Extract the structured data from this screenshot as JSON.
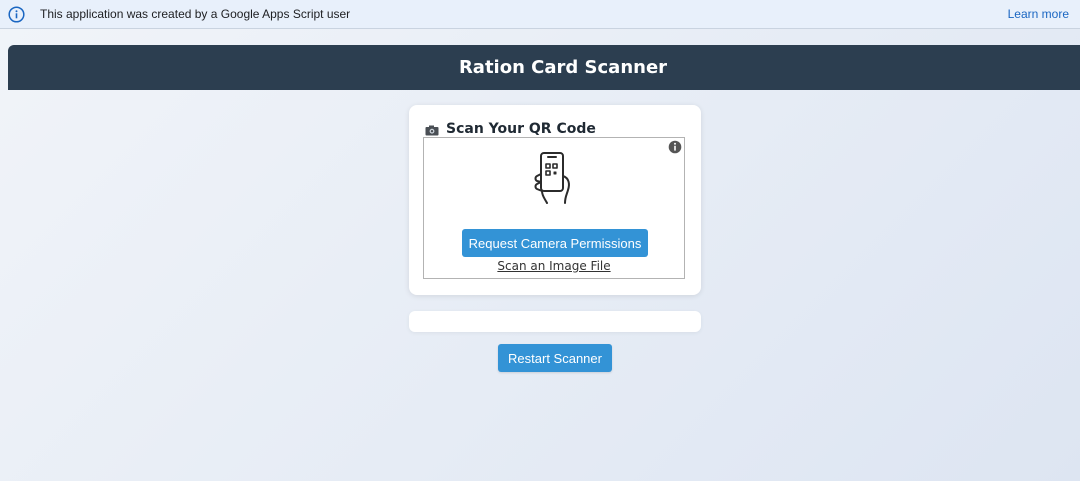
{
  "banner": {
    "text": "This application was created by a Google Apps Script user",
    "learn_more": "Learn more",
    "icon": "info-icon"
  },
  "header": {
    "title": "Ration Card Scanner",
    "background": "#2c3e50"
  },
  "scanner": {
    "heading": "Scan Your QR Code",
    "heading_icon": "camera-icon",
    "request_button": "Request Camera Permissions",
    "scan_file_link": "Scan an Image File",
    "illustration_icon": "qr-phone-icon",
    "info_icon": "info-icon"
  },
  "result": {
    "text": ""
  },
  "actions": {
    "restart_button": "Restart Scanner"
  },
  "colors": {
    "accent": "#3393d6",
    "banner_link": "#1a66c2"
  }
}
